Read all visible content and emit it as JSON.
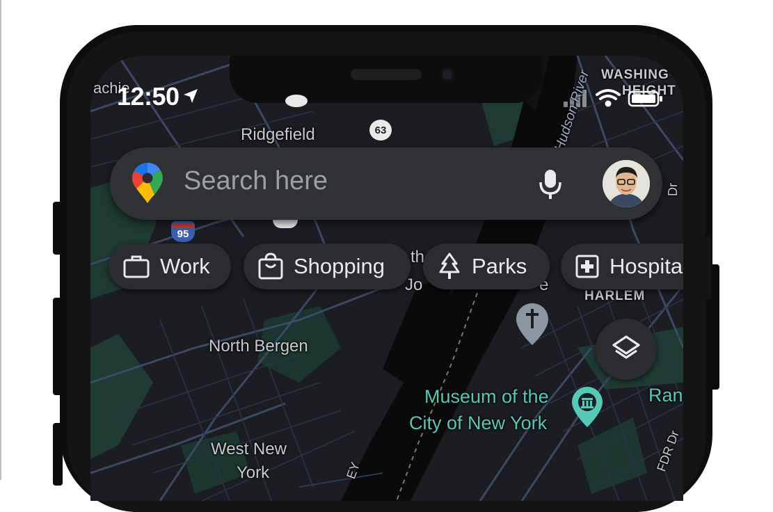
{
  "status_bar": {
    "time": "12:50",
    "corner_label_left": "achie",
    "corner_label_right_1": "WASHING",
    "corner_label_right_2": "HEIGHT"
  },
  "map_labels": {
    "ridgefield": "Ridgefield",
    "route_63": "63",
    "route_95": "95",
    "hudson_river": "Hudson River",
    "north_bergen": "North Bergen",
    "west_new_york_1": "West New",
    "west_new_york_2": "York",
    "harlem": "HARLEM",
    "museum_line1": "Museum of the",
    "museum_line2": "City of New York",
    "ran": "Ran",
    "fdr": "FDR Dr",
    "obscured_1": "th",
    "obscured_2": "Jo",
    "obscured_3": "e",
    "riverside": "Dr",
    "ey": "EY"
  },
  "search": {
    "placeholder": "Search here"
  },
  "chips": [
    {
      "label": "Work",
      "icon": "briefcase-icon"
    },
    {
      "label": "Shopping",
      "icon": "shopping-bag-icon"
    },
    {
      "label": "Parks",
      "icon": "tree-icon"
    },
    {
      "label": "Hospita",
      "icon": "hospital-icon"
    }
  ],
  "colors": {
    "map_bg": "#1b1d22",
    "water": "#0a0a0b",
    "green": "#1e3a32",
    "roads": "#3a4a66",
    "chip_bg": "#2b2c2f",
    "search_bg": "#303134",
    "teal_poi": "#56c9b6"
  }
}
